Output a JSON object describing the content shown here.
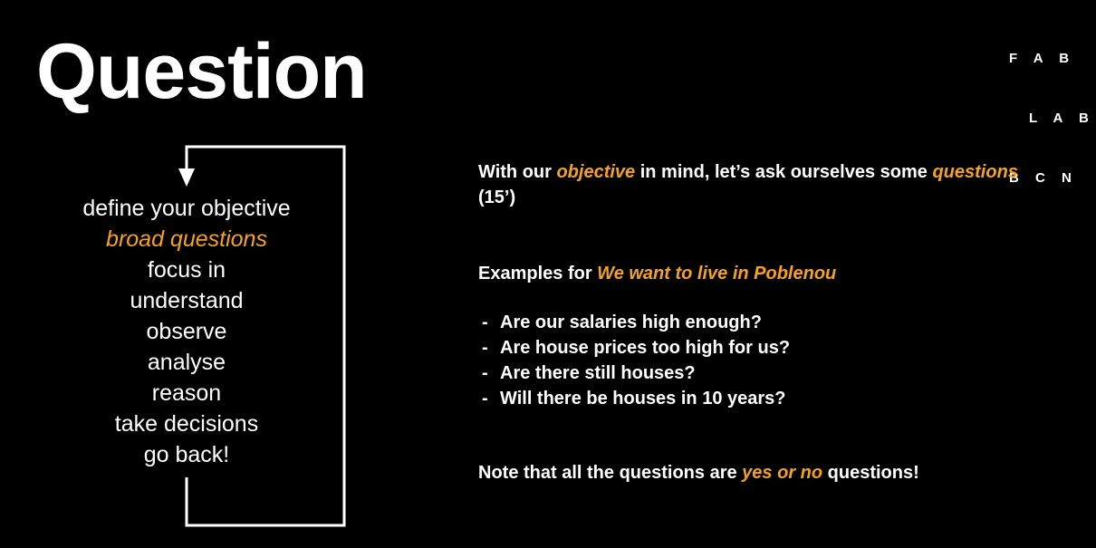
{
  "slide": {
    "title": "Question",
    "logo": [
      "F A B",
      "L A B",
      "B C N"
    ]
  },
  "steps": [
    {
      "text": "define your objective",
      "highlight": false
    },
    {
      "text": "broad questions",
      "highlight": true
    },
    {
      "text": "focus in",
      "highlight": false
    },
    {
      "text": "understand",
      "highlight": false
    },
    {
      "text": "observe",
      "highlight": false
    },
    {
      "text": "analyse",
      "highlight": false
    },
    {
      "text": "reason",
      "highlight": false
    },
    {
      "text": "take decisions",
      "highlight": false
    },
    {
      "text": "go back!",
      "highlight": false
    }
  ],
  "intro": {
    "part1": "With our ",
    "accent1": "objective",
    "part2": " in mind, let’s ask ourselves some ",
    "accent2": "questions",
    "part3": " (15’)"
  },
  "examples": {
    "prefix": "Examples for ",
    "accent": "We want to live in Poblenou"
  },
  "questions": [
    "Are our salaries high enough?",
    "Are house prices too high for us?",
    "Are there still houses?",
    "Will there be houses in 10 years?"
  ],
  "note": {
    "prefix": "Note that all the questions are ",
    "accent": "yes or no",
    "suffix": " questions!"
  },
  "colors": {
    "background": "#000000",
    "text": "#ffffff",
    "accent": "#f7a21b",
    "loop_line": "#ffffff"
  },
  "icons": {
    "loop_arrow": "arrow-down-icon"
  }
}
